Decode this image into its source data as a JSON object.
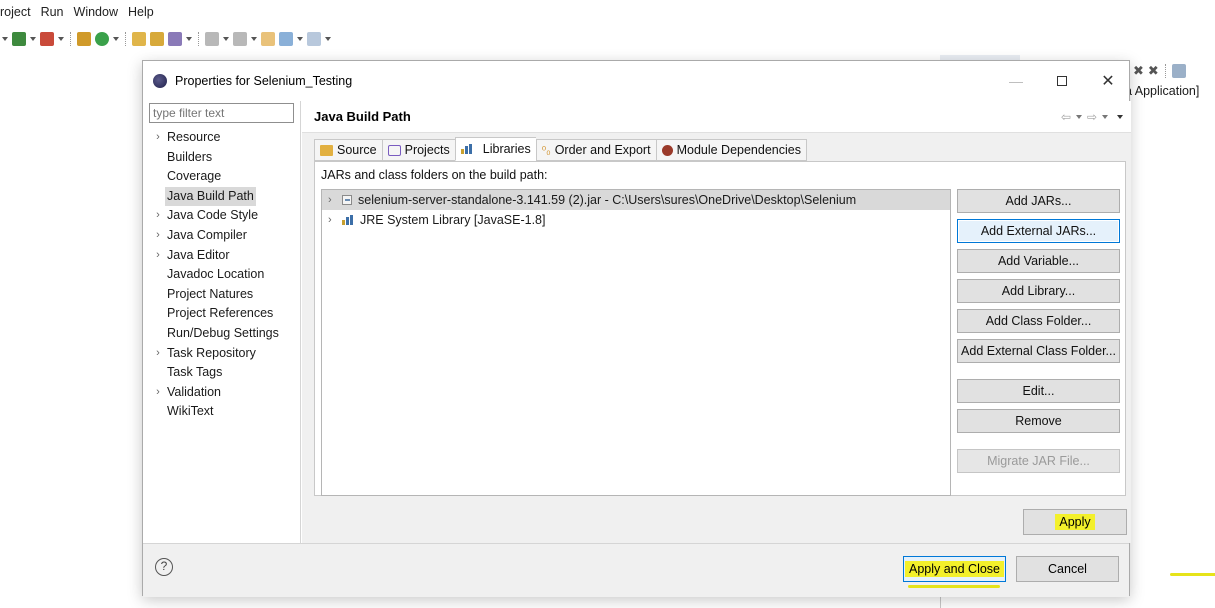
{
  "menubar": {
    "items": [
      "roject",
      "Run",
      "Window",
      "Help"
    ]
  },
  "background": {
    "right_text": "a Application]"
  },
  "dialog": {
    "title": "Properties for Selenium_Testing",
    "filter_placeholder": "type filter text",
    "tree": [
      {
        "label": "Resource",
        "expandable": true
      },
      {
        "label": "Builders",
        "expandable": false
      },
      {
        "label": "Coverage",
        "expandable": false
      },
      {
        "label": "Java Build Path",
        "expandable": false,
        "selected": true
      },
      {
        "label": "Java Code Style",
        "expandable": true
      },
      {
        "label": "Java Compiler",
        "expandable": true
      },
      {
        "label": "Java Editor",
        "expandable": true
      },
      {
        "label": "Javadoc Location",
        "expandable": false
      },
      {
        "label": "Project Natures",
        "expandable": false
      },
      {
        "label": "Project References",
        "expandable": false
      },
      {
        "label": "Run/Debug Settings",
        "expandable": false
      },
      {
        "label": "Task Repository",
        "expandable": true
      },
      {
        "label": "Task Tags",
        "expandable": false
      },
      {
        "label": "Validation",
        "expandable": true
      },
      {
        "label": "WikiText",
        "expandable": false
      }
    ],
    "page_title": "Java Build Path",
    "tabs": [
      {
        "label": "Source"
      },
      {
        "label": "Projects"
      },
      {
        "label": "Libraries",
        "active": true
      },
      {
        "label": "Order and Export"
      },
      {
        "label": "Module Dependencies"
      }
    ],
    "jars_label": "JARs and class folders on the build path:",
    "libraries": [
      {
        "label": "selenium-server-standalone-3.141.59 (2).jar - C:\\Users\\sures\\OneDrive\\Desktop\\Selenium",
        "selected": true
      },
      {
        "label": "JRE System Library [JavaSE-1.8]",
        "selected": false
      }
    ],
    "buttons": {
      "add_jars": "Add JARs...",
      "add_external_jars": "Add External JARs...",
      "add_variable": "Add Variable...",
      "add_library": "Add Library...",
      "add_class_folder": "Add Class Folder...",
      "add_external_class_folder": "Add External Class Folder...",
      "edit": "Edit...",
      "remove": "Remove",
      "migrate_jar": "Migrate JAR File..."
    },
    "apply": "Apply",
    "apply_and_close": "Apply and Close",
    "cancel": "Cancel",
    "help_glyph": "?"
  },
  "colors": {
    "highlight": "#f3f02b",
    "focus_border": "#0078d7"
  }
}
